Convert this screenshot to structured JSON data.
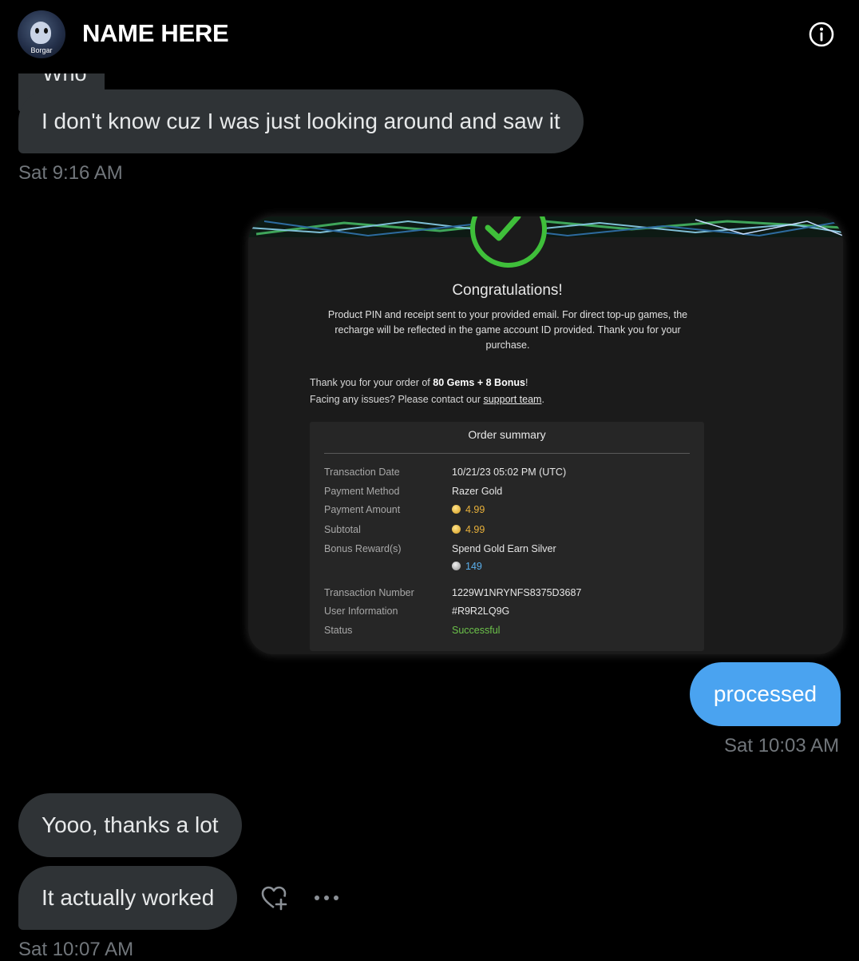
{
  "header": {
    "contact_name": "NAME HERE",
    "avatar_label": "Borgar",
    "info_icon": "info-circle-icon"
  },
  "messages": {
    "partial_text": "Who",
    "m1": "I don't know cuz I was just looking around and saw it",
    "ts1": "Sat 9:16 AM",
    "sent": "processed",
    "ts2": "Sat 10:03 AM",
    "m3": "Yooo, thanks a lot",
    "m4": "It actually worked",
    "ts3": "Sat 10:07 AM",
    "react_icon": "heart-plus-icon",
    "more_icon": "more-dots-icon"
  },
  "receipt": {
    "title": "Congratulations!",
    "message": "Product PIN and receipt sent to your provided email. For direct top-up games, the recharge will be reflected in the game account ID provided. Thank you for your purchase.",
    "order_prefix": "Thank you for your order of ",
    "order_item": "80 Gems + 8 Bonus",
    "order_suffix": "!",
    "issues_prefix": "Facing any issues? Please contact our ",
    "issues_link": "support team",
    "issues_suffix": ".",
    "summary_title": "Order summary",
    "rows": {
      "transaction_date": {
        "label": "Transaction Date",
        "value": "10/21/23 05:02 PM (UTC)"
      },
      "payment_method": {
        "label": "Payment Method",
        "value": "Razer Gold"
      },
      "payment_amount": {
        "label": "Payment Amount",
        "value": "4.99"
      },
      "subtotal": {
        "label": "Subtotal",
        "value": "4.99"
      },
      "bonus_reward": {
        "label": "Bonus Reward(s)",
        "value": "Spend Gold Earn Silver",
        "silver": "149"
      },
      "transaction_number": {
        "label": "Transaction Number",
        "value": "1229W1NRYNFS8375D3687"
      },
      "user_information": {
        "label": "User Information",
        "value": "#R9R2LQ9G"
      },
      "status": {
        "label": "Status",
        "value": "Successful"
      }
    },
    "colors": {
      "check": "#3fbf3a",
      "gold": "#e8b03a",
      "silver_value": "#5aaeea",
      "status": "#6cc24a"
    }
  },
  "colors": {
    "background": "#000000",
    "received_bubble": "#2f3336",
    "sent_bubble": "#4aa3f0",
    "timestamp": "#71767b"
  }
}
